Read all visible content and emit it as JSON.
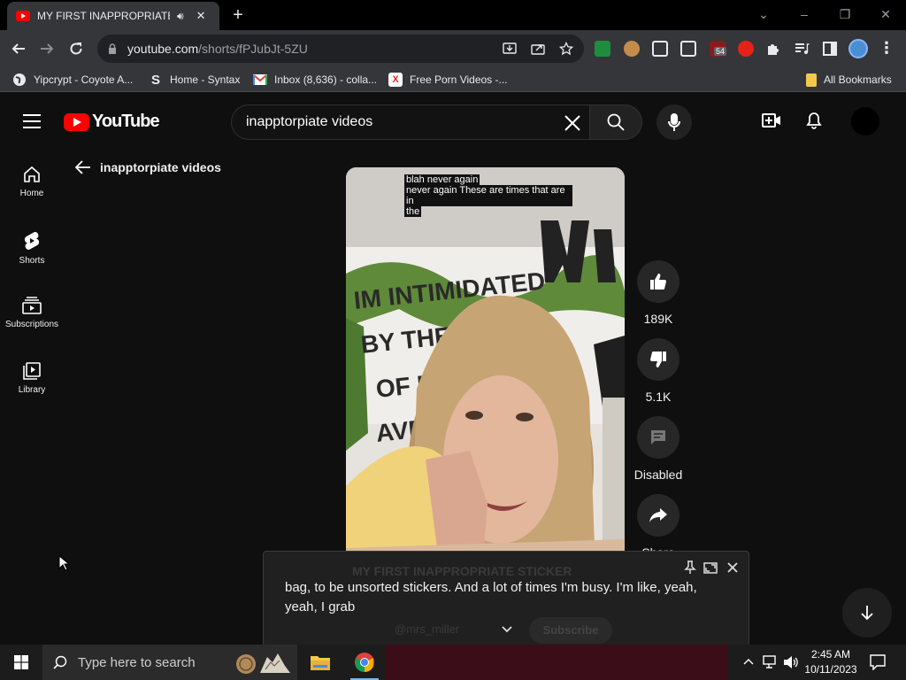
{
  "browser": {
    "tab_title": "MY FIRST INAPPROPRIATE S",
    "new_tab_symbol": "+",
    "url_domain": "youtube.com",
    "url_path": "/shorts/fPJubJt-5ZU",
    "extension_badge": "54",
    "window_controls": [
      "⌄",
      "–",
      "❐",
      "✕"
    ]
  },
  "bookmarks": [
    {
      "label": "Yipcrypt - Coyote A...",
      "icon": "globe-icon"
    },
    {
      "label": "Home - Syntax",
      "icon": "S"
    },
    {
      "label": "Inbox (8,636) - colla...",
      "icon": "gmail-icon"
    },
    {
      "label": "Free Porn Videos -...",
      "icon": "X"
    }
  ],
  "all_bookmarks_label": "All Bookmarks",
  "youtube": {
    "logo_text": "YouTube",
    "search_value": "inapptorpiate videos",
    "back_label": "inapptorpiate videos",
    "sidebar": [
      {
        "label": "Home",
        "icon": "home-icon"
      },
      {
        "label": "Shorts",
        "icon": "shorts-icon"
      },
      {
        "label": "Subscriptions",
        "icon": "subscriptions-icon"
      },
      {
        "label": "Library",
        "icon": "library-icon"
      }
    ],
    "video": {
      "overlay_caption": [
        "blah never again",
        "never again These are times that are in",
        "the"
      ],
      "title": "MY FIRST INAPPROPRIATE STICKER",
      "channel": "@mrs_miller",
      "subscribe_label": "Subscribe"
    },
    "actions": {
      "like_count": "189K",
      "dislike_count": "5.1K",
      "comments_label": "Disabled",
      "share_label": "Share"
    },
    "caption_text": "bag, to be unsorted stickers. And a lot of times I'm busy. I'm like, yeah, yeah, I grab"
  },
  "taskbar": {
    "search_placeholder": "Type here to search",
    "time": "2:45 AM",
    "date": "10/11/2023"
  }
}
